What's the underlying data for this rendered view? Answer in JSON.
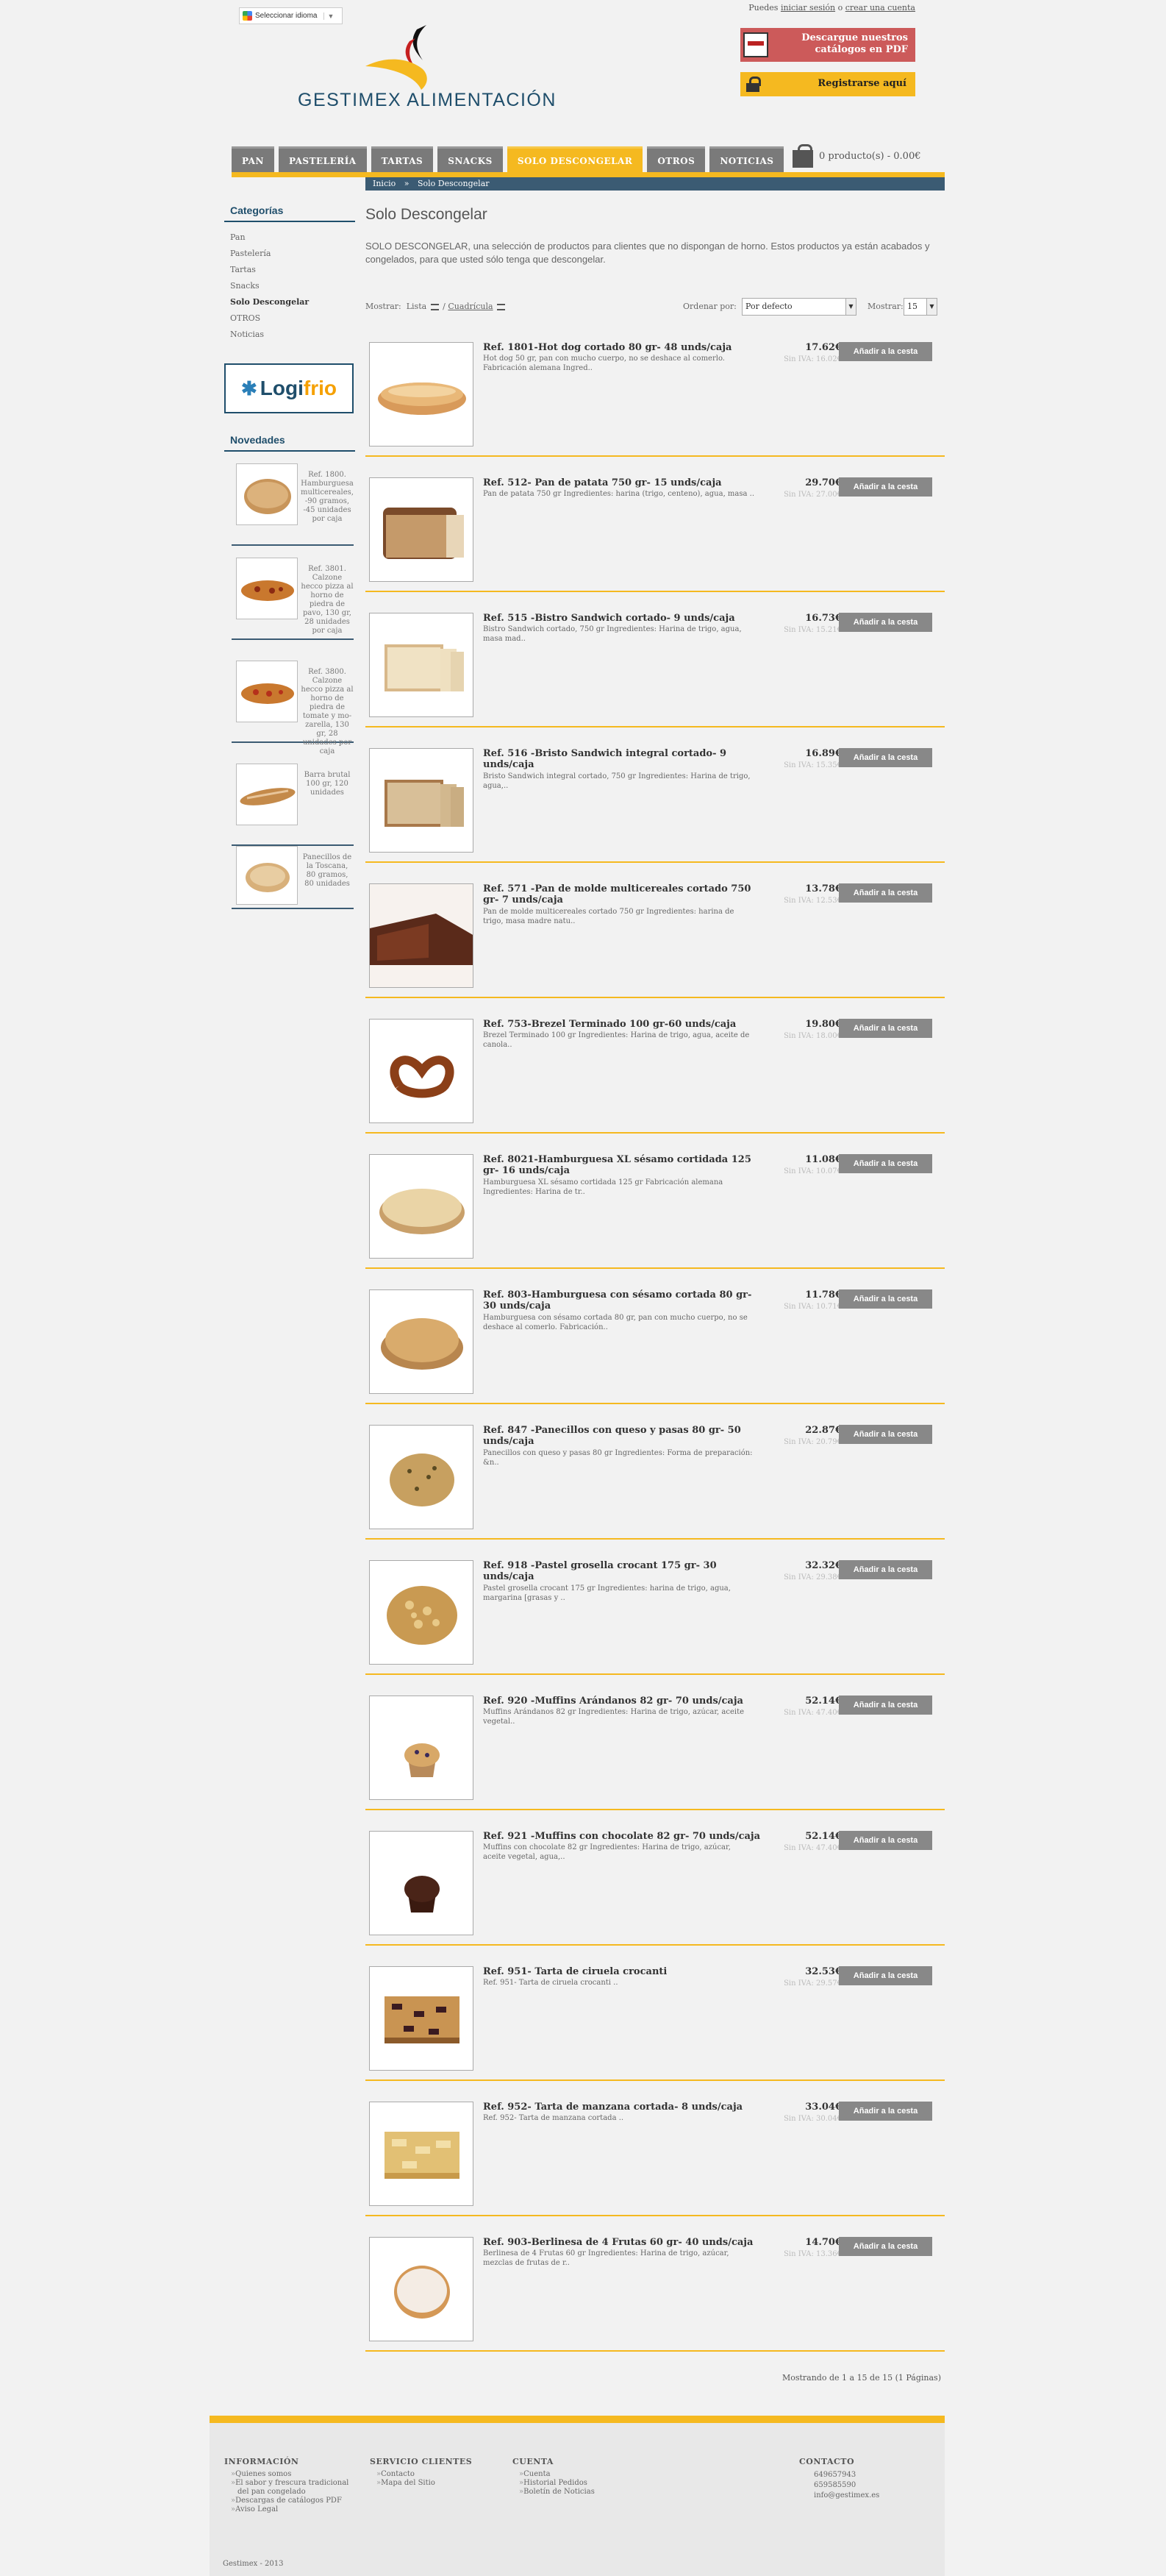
{
  "header": {
    "lang_label": "Seleccionar idioma",
    "lang_caret": "▼",
    "brand_name": "GESTIMEX ALIMENTACIÓN",
    "top_prefix": "Puedes",
    "login": "iniciar sesión",
    "or": "o",
    "create": "crear una cuenta",
    "pdf": "Descargue nuestros catálogos en PDF",
    "register": "Registrarse aquí"
  },
  "nav": [
    "PAN",
    "PASTELERÍA",
    "TARTAS",
    "SNACKS",
    "SOLO DESCONGELAR",
    "OTROS",
    "NOTICIAS"
  ],
  "cart": "0 producto(s) - 0.00€",
  "breadcrumb": {
    "home": "Inicio",
    "sep": "»",
    "current": "Solo Descongelar"
  },
  "sidebar": {
    "cat_title": "Categorías",
    "categories": [
      "Pan",
      "Pastelería",
      "Tartas",
      "Snacks",
      "Solo Descongelar",
      "OTROS",
      "Noticias"
    ],
    "novedades_title": "Novedades",
    "novedades": [
      "Ref. 1800. Hamburguesa multicereales, -90 gramos, -45 unidades por caja",
      "Ref. 3801. Calzone hecco pizza al horno de piedra de pavo, 130 gr, 28 unidades por caja",
      "Ref. 3800. Calzone hecco pizza al horno de piedra de tomate y mo-zarella, 130 gr, 28 unidades por caja",
      "Barra brutal 100 gr, 120 unidades",
      "Panecillos de la Toscana, 80 gramos, 80 unidades"
    ]
  },
  "main": {
    "title": "Solo Descongelar",
    "intro": "SOLO DESCONGELAR, una selección de productos para clientes que no dispongan de horno. Estos productos ya están acabados y congelados, para que usted sólo tenga que descongelar.",
    "show_label": "Mostrar:",
    "list": "Lista",
    "grid": "Cuadrícula",
    "sort_label": "Ordenar por:",
    "sort_value": "Por defecto",
    "show2_label": "Mostrar:",
    "show2_value": "15",
    "add_label": "Añadir a la cesta",
    "count": "Mostrando de 1 a 15 de 15 (1 Páginas)"
  },
  "products": [
    {
      "name": "Ref. 1801-Hot dog cortado 80 gr- 48 unds/caja",
      "desc": "Hot dog 50 gr, pan con mucho cuerpo, no se deshace al comerlo. Fabricación alemana Ingred..",
      "price": "17.62€",
      "siniva": "Sin IVA: 16.02€",
      "img": "hotdog"
    },
    {
      "name": "Ref. 512- Pan de patata 750 gr- 15 unds/caja",
      "desc": " Pan de patata 750 gr   Ingredientes: harina (trigo, centeno), agua, masa ..",
      "price": "29.70€",
      "siniva": "Sin IVA: 27.00€",
      "img": "loaf"
    },
    {
      "name": "Ref. 515 -Bistro Sandwich cortado- 9 unds/caja",
      "desc": "Bistro Sandwich cortado, 750 gr    Ingredientes: Harina de trigo, agua, masa mad..",
      "price": "16.73€",
      "siniva": "Sin IVA: 15.21€",
      "img": "sandwich"
    },
    {
      "name": "Ref. 516 -Bristo Sandwich integral cortado- 9 unds/caja",
      "desc": "Bristo Sandwich integral cortado, 750 gr    Ingredientes: Harina de trigo, agua,..",
      "price": "16.89€",
      "siniva": "Sin IVA: 15.35€",
      "img": "sandwich2"
    },
    {
      "name": "Ref. 571 -Pan de molde multicereales cortado 750 gr- 7 unds/caja",
      "desc": "Pan de molde multicereales cortado 750 gr Ingredientes: harina de trigo, masa madre natu..",
      "price": "13.78€",
      "siniva": "Sin IVA: 12.53€",
      "img": "molde"
    },
    {
      "name": "Ref. 753-Brezel Terminado 100 gr-60 unds/caja",
      "desc": "Brezel Terminado 100 gr    Ingredientes: Harina de trigo, agua, aceite de canola..",
      "price": "19.80€",
      "siniva": "Sin IVA: 18.00€",
      "img": "pretzel"
    },
    {
      "name": "Ref. 8021-Hamburguesa XL sésamo cortidada 125 gr- 16 unds/caja",
      "desc": "Hamburguesa XL sésamo cortidada 125 gr Fabricación alemana Ingredientes: Harina de tr..",
      "price": "11.08€",
      "siniva": "Sin IVA: 10.07€",
      "img": "burger"
    },
    {
      "name": "Ref. 803-Hamburguesa con sésamo cortada 80 gr- 30 unds/caja",
      "desc": "Hamburguesa con sésamo cortada 80 gr, pan con mucho cuerpo, no se deshace al comerlo. Fabricación..",
      "price": "11.78€",
      "siniva": "Sin IVA: 10.71€",
      "img": "burger2"
    },
    {
      "name": "Ref. 847 -Panecillos con queso y pasas 80 gr- 50 unds/caja",
      "desc": "Panecillos con queso y pasas 80 gr Ingredientes:  Forma de preparación: &n..",
      "price": "22.87€",
      "siniva": "Sin IVA: 20.79€",
      "img": "roll"
    },
    {
      "name": "Ref. 918 -Pastel grosella crocant 175 gr- 30 unds/caja",
      "desc": "Pastel grosella crocant 175 gr Ingredientes: harina de trigo, agua, margarina [grasas y ..",
      "price": "32.32€",
      "siniva": "Sin IVA: 29.38€",
      "img": "crumble"
    },
    {
      "name": "Ref. 920 -Muffins Arándanos 82 gr- 70 unds/caja",
      "desc": "Muffins Arándanos 82 gr    Ingredientes: Harina de trigo, azúcar, aceite vegetal..",
      "price": "52.14€",
      "siniva": "Sin IVA: 47.40€",
      "img": "muffin"
    },
    {
      "name": "Ref. 921 -Muffins con chocolate 82 gr- 70 unds/caja",
      "desc": "Muffins con chocolate 82 gr Ingredientes: Harina de trigo, azúcar, aceite vegetal, agua,..",
      "price": "52.14€",
      "siniva": "Sin IVA: 47.40€",
      "img": "muffin2"
    },
    {
      "name": "Ref. 951- Tarta de ciruela crocanti",
      "desc": "Ref. 951- Tarta de ciruela crocanti ..",
      "price": "32.53€",
      "siniva": "Sin IVA: 29.57€",
      "img": "tart"
    },
    {
      "name": "Ref. 952- Tarta de manzana cortada- 8 unds/caja",
      "desc": "Ref. 952- Tarta de manzana cortada ..",
      "price": "33.04€",
      "siniva": "Sin IVA: 30.04€",
      "img": "tart2"
    },
    {
      "name": "Ref. 903-Berlinesa de 4 Frutas 60 gr- 40 unds/caja",
      "desc": "Berlinesa de 4 Frutas 60 gr Ingredientes:  Harina de trigo, azúcar, mezclas de frutas de r..",
      "price": "14.70€",
      "siniva": "Sin IVA: 13.36€",
      "img": "donut"
    }
  ],
  "footer": {
    "info_title": "INFORMACIÓN",
    "info": [
      "Quienes somos",
      "El sabor y frescura tradicional del pan congelado",
      "Descargas de catálogos PDF",
      "Aviso Legal"
    ],
    "serv_title": "SERVICIO CLIENTES",
    "serv": [
      "Contacto",
      "Mapa del Sitio"
    ],
    "acc_title": "CUENTA",
    "acc": [
      "Cuenta",
      "Historial Pedidos",
      "Boletín de Noticias"
    ],
    "contact_title": "CONTACTO",
    "contact": [
      "649657943",
      "659585590",
      "info@gestimex.es"
    ],
    "copy": "Gestimex - 2013"
  }
}
